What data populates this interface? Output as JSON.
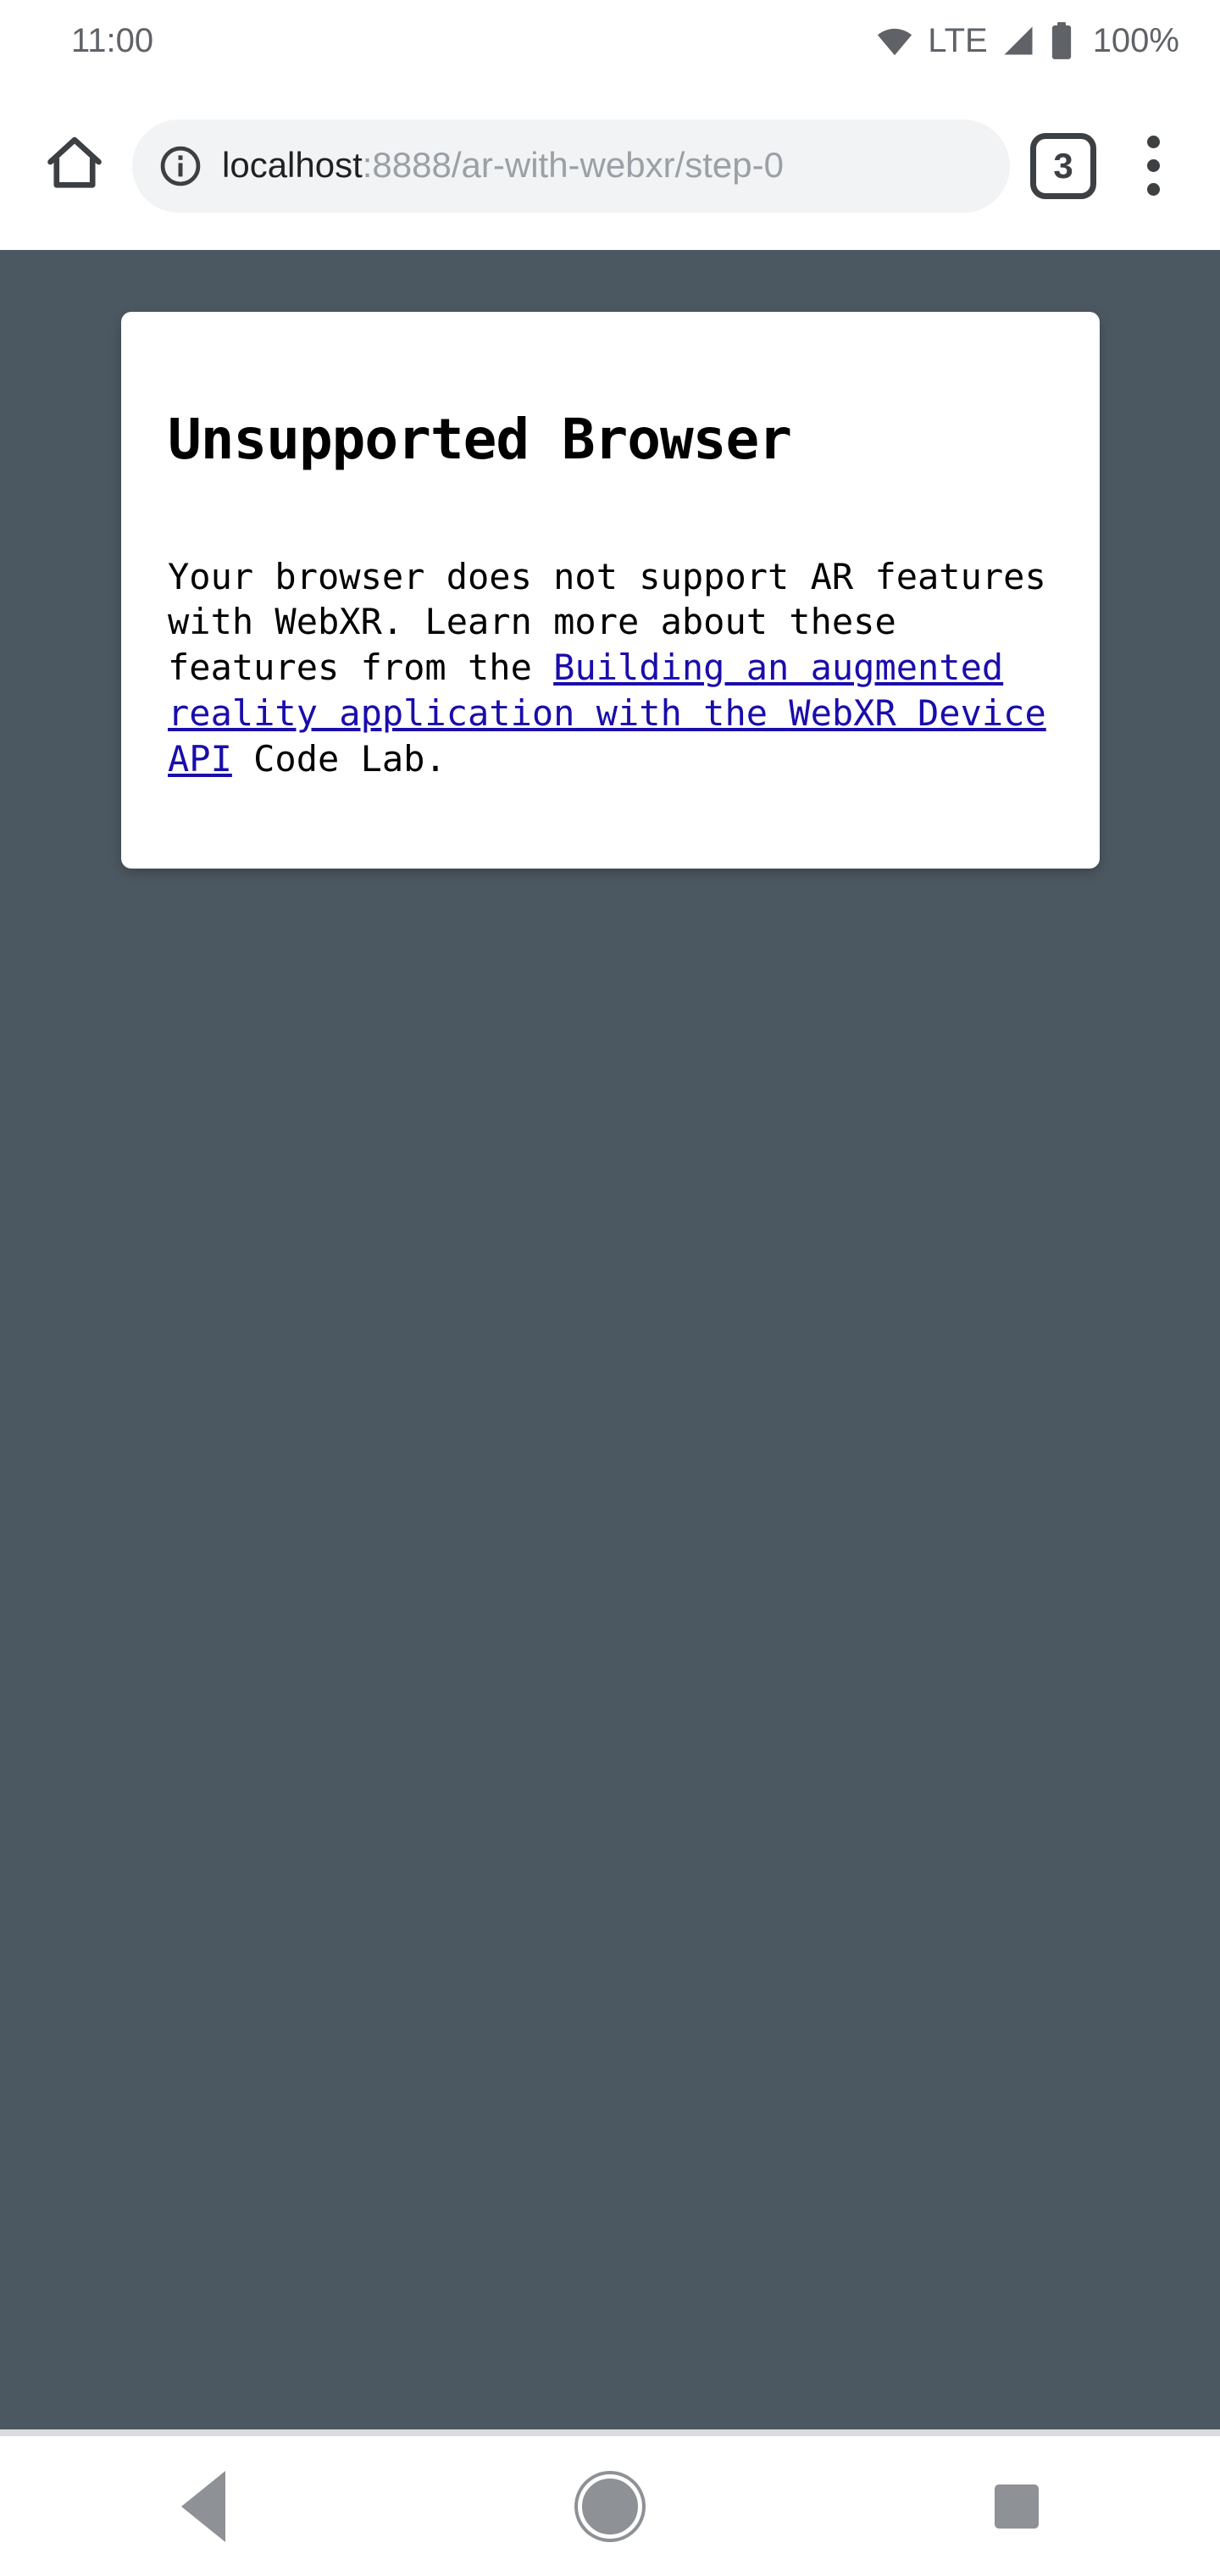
{
  "status_bar": {
    "clock": "11:00",
    "network_label": "LTE",
    "battery_percent": "100%",
    "icons": [
      "wifi-icon",
      "signal-icon",
      "battery-icon"
    ]
  },
  "browser": {
    "home_icon": "home-icon",
    "omnibox": {
      "security_icon": "info-icon",
      "url_host": "localhost",
      "url_path": ":8888/ar-with-webxr/step-0",
      "url_full": "localhost:8888/ar-with-webxr/step-0"
    },
    "tab_count": "3",
    "overflow_icon": "more-vertical-icon"
  },
  "page": {
    "background_color": "#4c5861",
    "card": {
      "title": "Unsupported Browser",
      "body_prefix": "Your browser does not support AR features with WebXR. Learn more about these features from the ",
      "link_text": "Building an augmented reality application with the WebXR Device API",
      "body_suffix": " Code Lab.",
      "link_color": "#1a0dab"
    }
  },
  "nav_bar": {
    "back_label": "back-icon",
    "home_label": "home-circle-icon",
    "recents_label": "recents-square-icon"
  }
}
